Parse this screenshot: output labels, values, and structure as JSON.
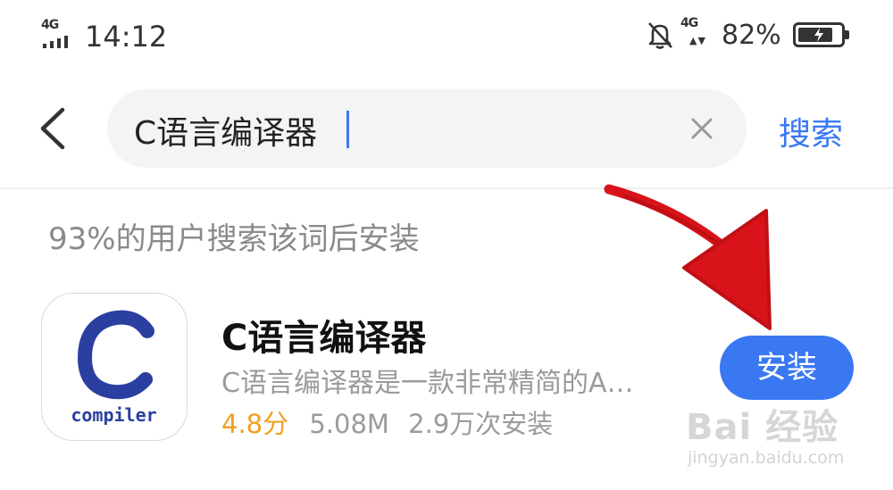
{
  "status_bar": {
    "network_left": "4G",
    "time": "14:12",
    "network_right": "4G",
    "battery_percent": "82%",
    "battery_level": 0.82
  },
  "search": {
    "query": "C语言编译器",
    "submit_label": "搜索"
  },
  "hint_text": "93%的用户搜索该词后安装",
  "app": {
    "icon_label": "compiler",
    "name": "C语言编译器",
    "description": "C语言编译器是一款非常精简的A…",
    "rating": "4.8分",
    "size": "5.08M",
    "installs": "2.9万次安装",
    "install_label": "安装"
  },
  "watermark": {
    "logo": "Bai 经验",
    "url": "jingyan.baidu.com"
  },
  "colors": {
    "accent": "#3a78f2",
    "rating": "#f0a020",
    "arrow": "#d8141a"
  }
}
